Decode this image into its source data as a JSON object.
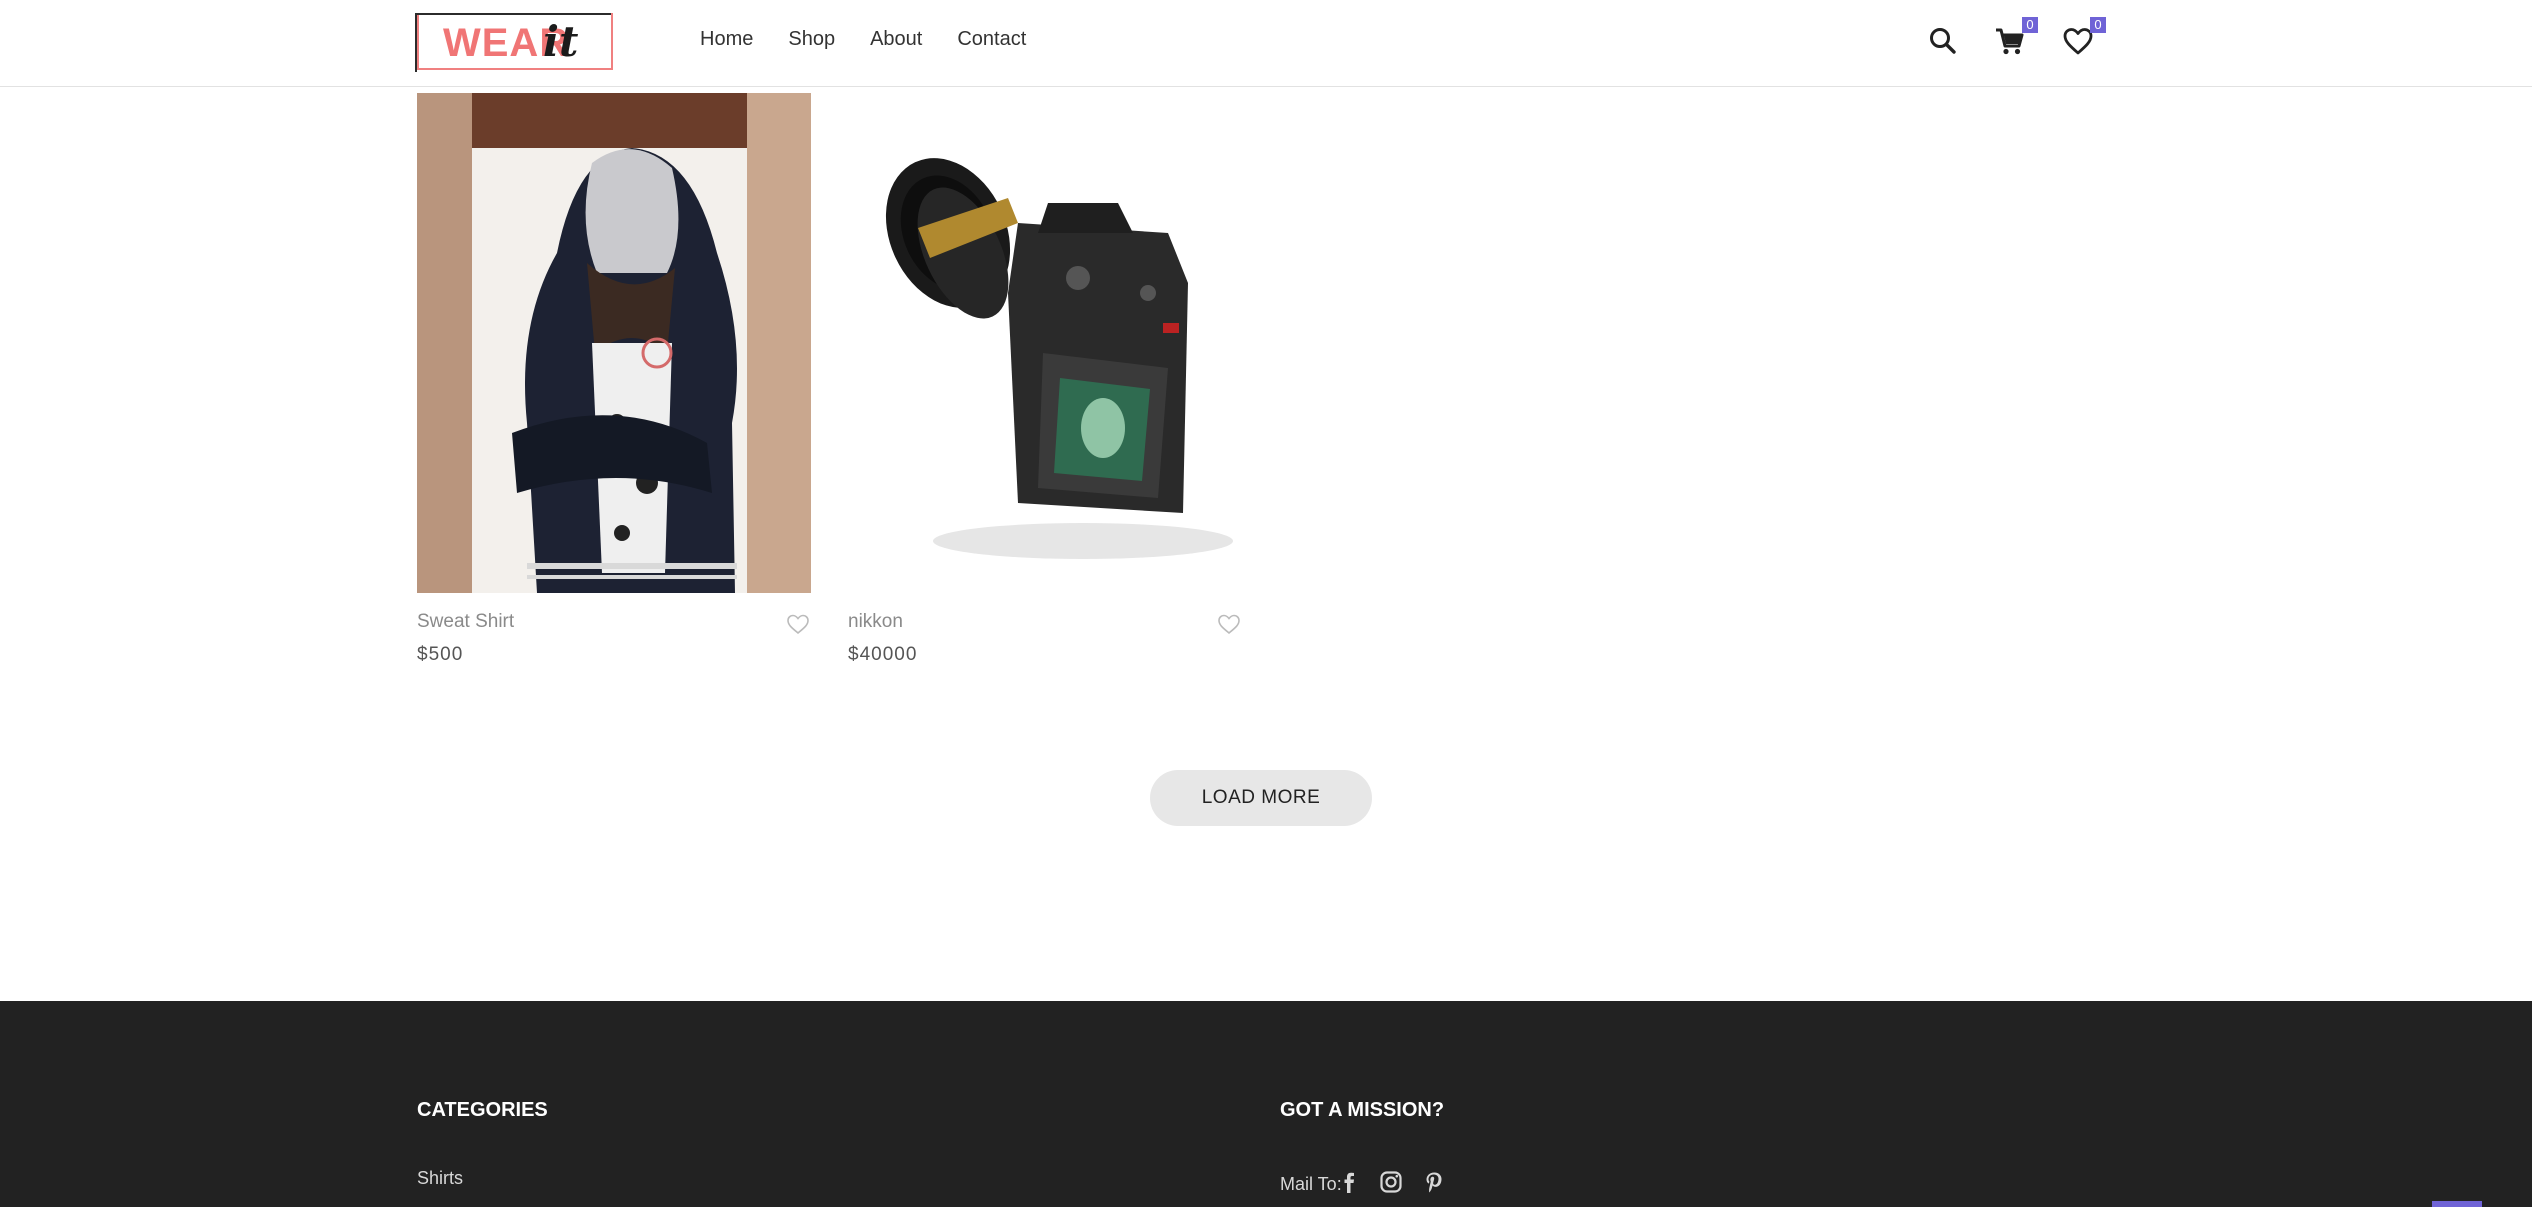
{
  "header": {
    "logo_text_primary": "WEAR",
    "logo_text_secondary": "it",
    "nav": [
      "Home",
      "Shop",
      "About",
      "Contact"
    ],
    "cart_count": "0",
    "wishlist_count": "0",
    "icons": [
      "search-icon",
      "cart-icon",
      "heart-icon"
    ]
  },
  "products": [
    {
      "name": "Sweat Shirt",
      "price": "$500",
      "image": "hooded-sweatshirt-photo"
    },
    {
      "name": "nikkon",
      "price": "$40000",
      "image": "dslr-camera-photo"
    }
  ],
  "load_more_label": "LOAD MORE",
  "footer": {
    "categories_heading": "CATEGORIES",
    "categories": [
      "Shirts"
    ],
    "mission_heading": "GOT A MISSION?",
    "mail_label": "Mail To:",
    "social_icons": [
      "facebook-icon",
      "instagram-icon",
      "pinterest-icon"
    ]
  },
  "colors": {
    "accent": "#6f63d6",
    "logo_pink": "#f07575",
    "footer_bg": "#222222",
    "button_bg": "#e7e7e7"
  }
}
